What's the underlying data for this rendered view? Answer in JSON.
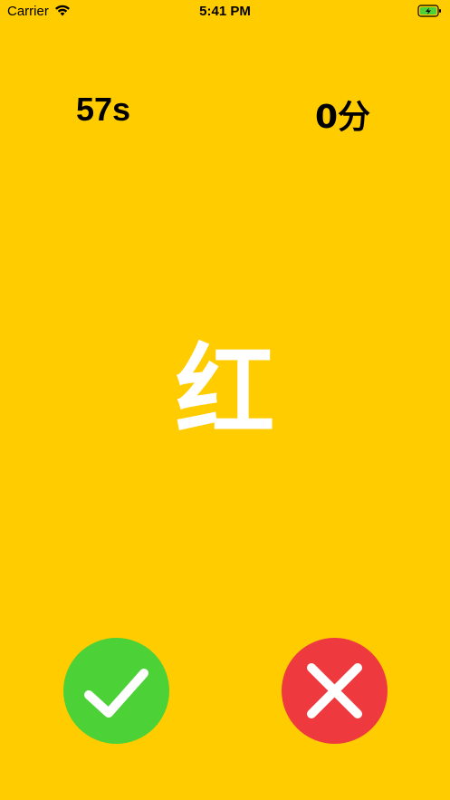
{
  "status_bar": {
    "carrier": "Carrier",
    "time": "5:41 PM",
    "battery_color": "#4CD137",
    "icons": [
      "wifi-icon",
      "battery-charging-icon"
    ]
  },
  "game": {
    "timer": "57s",
    "score": "0分",
    "word": "红",
    "word_color": "#FFFFFF",
    "background_color": "#FFCC00"
  },
  "buttons": {
    "correct": {
      "icon": "checkmark-icon",
      "color": "#4CD137"
    },
    "wrong": {
      "icon": "cross-icon",
      "color": "#EE3A3F"
    }
  }
}
